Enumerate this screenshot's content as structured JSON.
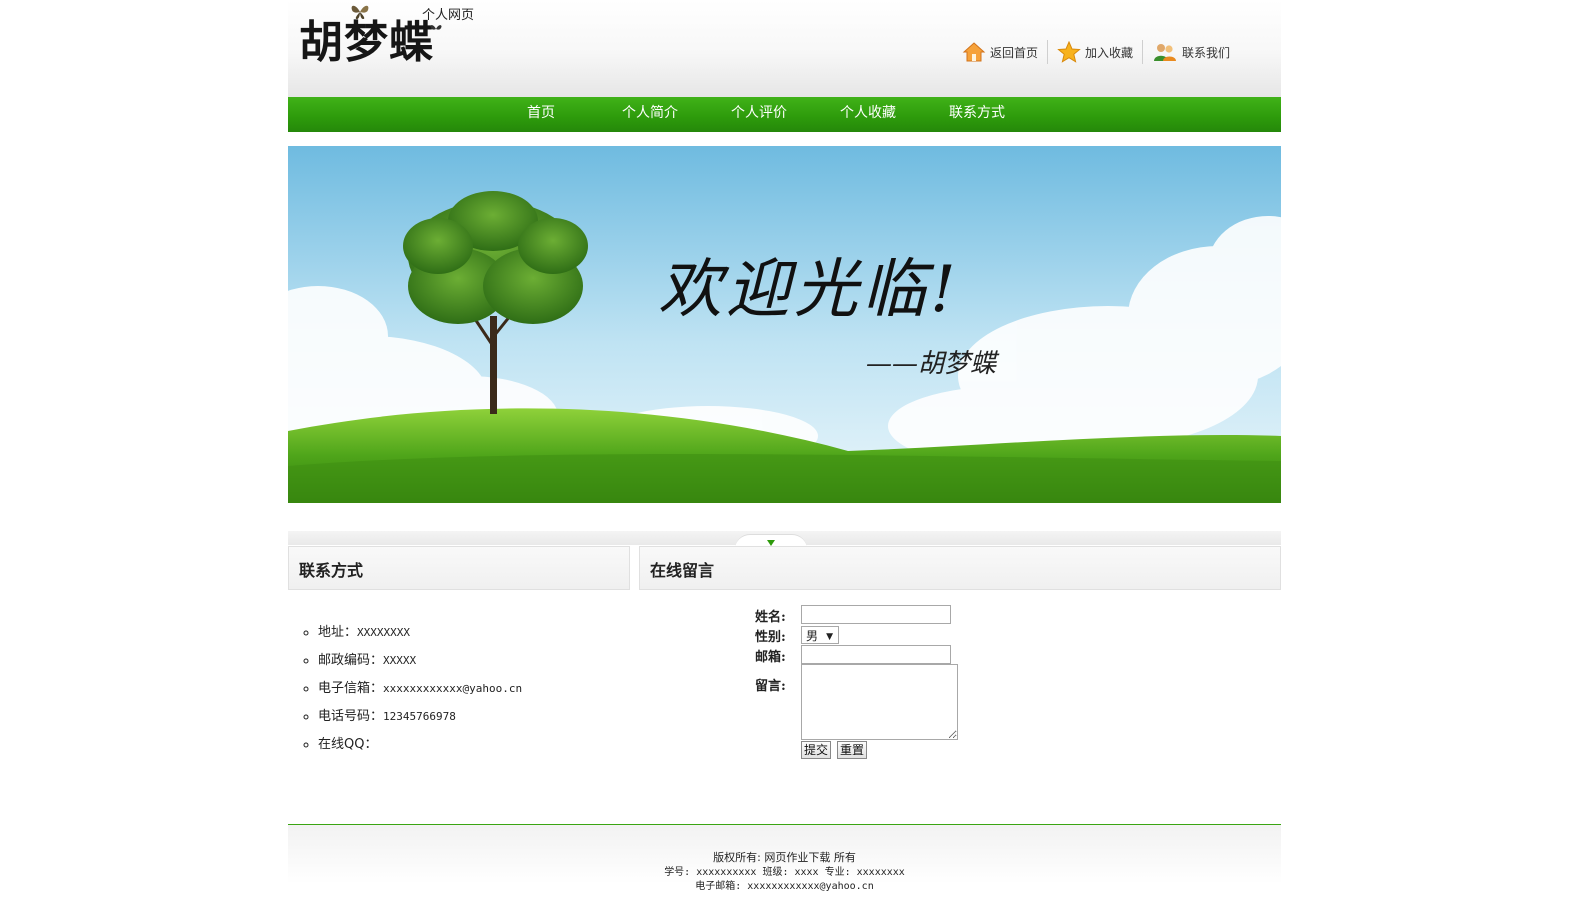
{
  "header": {
    "logo": "胡梦蝶",
    "subtitle": "个人网页",
    "links": [
      {
        "label": "返回首页",
        "icon": "home-icon"
      },
      {
        "label": "加入收藏",
        "icon": "star-icon"
      },
      {
        "label": "联系我们",
        "icon": "contact-people-icon"
      }
    ]
  },
  "nav": {
    "items": [
      "首页",
      "个人简介",
      "个人评价",
      "个人收藏",
      "联系方式"
    ]
  },
  "banner": {
    "welcome": "欢迎光临!",
    "signature": "——胡梦蝶"
  },
  "contact": {
    "title": "联系方式",
    "items": [
      {
        "label": "地址：",
        "value": "XXXXXXXX"
      },
      {
        "label": "邮政编码：",
        "value": "XXXXX"
      },
      {
        "label": "电子信箱：",
        "value": "xxxxxxxxxxxx@yahoo.cn"
      },
      {
        "label": "电话号码：",
        "value": "12345766978"
      },
      {
        "label": "在线QQ：",
        "value": ""
      }
    ]
  },
  "message": {
    "title": "在线留言",
    "name_label": "姓名:",
    "gender_label": "性别:",
    "gender_value": "男",
    "email_label": "邮箱:",
    "message_label": "留言:",
    "submit": "提交",
    "reset": "重置"
  },
  "footer": {
    "copyright_prefix": "版权所有:",
    "copyright_link": "网页作业下载",
    "copyright_suffix": "所有",
    "line2": "学号: xxxxxxxxxx 班级: xxxx 专业: xxxxxxxx",
    "line3": "电子邮箱: xxxxxxxxxxxx@yahoo.cn"
  },
  "colors": {
    "nav_green": "#2d9a0b",
    "footer_rule": "#3aa512"
  }
}
